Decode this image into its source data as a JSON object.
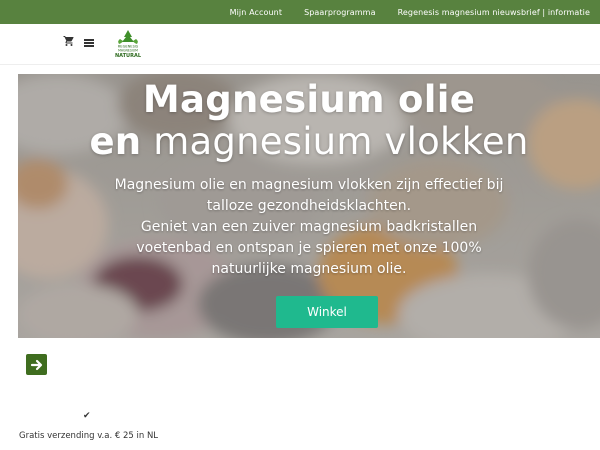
{
  "topbar": {
    "links": [
      "Mijn Account",
      "Spaarprogramma",
      "Regenesis magnesium nieuwsbrief | informatie"
    ],
    "bg_color": "#58823f"
  },
  "header": {
    "icons": [
      "cart-icon",
      "menu-icon"
    ],
    "logo_lines": [
      "REGENESIS",
      "MAGNESIUM",
      "NATURAL"
    ]
  },
  "hero": {
    "title_line1": "Magnesium olie",
    "title_line2_bold": "en",
    "title_line2_rest": " magnesium vlokken",
    "text_lines": [
      "Magnesium olie en magnesium vlokken zijn effectief bij talloze gezondheidsklachten.",
      "Geniet van een zuiver magnesium badkristallen voetenbad en ontspan je spieren met onze 100% natuurlijke magnesium olie."
    ],
    "button_label": "Winkel",
    "button_color": "#1fb98e"
  },
  "usp": {
    "arrow_icon": "arrow-right-icon",
    "check_icon": "check-icon",
    "shipping_text": "Gratis verzending v.a. € 25 in NL"
  }
}
